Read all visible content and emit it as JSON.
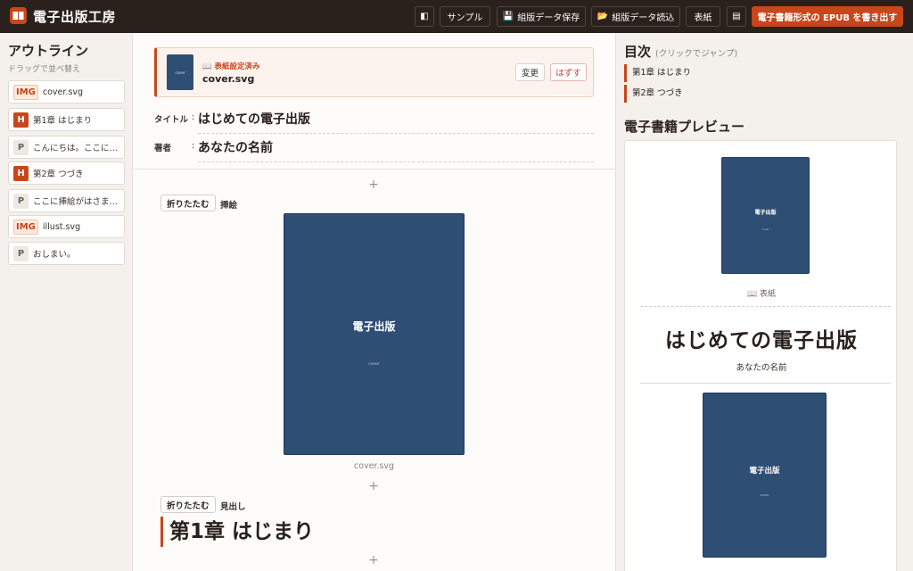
{
  "app": {
    "title": "電子出版工房"
  },
  "toolbar": {
    "toggle_icon": "sidebar-toggle-icon",
    "sample": "サンプル",
    "save": "組版データ保存",
    "load": "組版データ読込",
    "cover": "表紙",
    "menu_icon": "menu-icon",
    "export": "電子書籍形式の EPUB を書き出す"
  },
  "outline": {
    "title": "アウトライン",
    "subtitle": "ドラッグで並べ替え",
    "items": [
      {
        "badge": "IMG",
        "kind": "img",
        "text": "cover.svg"
      },
      {
        "badge": "H",
        "kind": "h",
        "text": "第1章 はじまり"
      },
      {
        "badge": "P",
        "kind": "p",
        "text": "こんにちは。ここに…"
      },
      {
        "badge": "H",
        "kind": "h",
        "text": "第2章 つづき"
      },
      {
        "badge": "P",
        "kind": "p",
        "text": "ここに挿絵がはさま…"
      },
      {
        "badge": "IMG",
        "kind": "img",
        "text": "illust.svg"
      },
      {
        "badge": "P",
        "kind": "p",
        "text": "おしまい。"
      }
    ]
  },
  "editor": {
    "cover": {
      "label": "📖 表紙設定済み",
      "file": "cover.svg",
      "thumb_text": "cover",
      "change": "変更",
      "remove": "はずす"
    },
    "meta": {
      "title_label": "タイトル",
      "title_value": "はじめての電子出版",
      "author_label": "著者",
      "author_value": "あなたの名前",
      "colon": ":"
    },
    "plus": "+",
    "blocks": [
      {
        "fold": "折りたたむ",
        "type": "挿絵",
        "image_title": "電子出版",
        "image_sub": "cover",
        "caption": "cover.svg"
      },
      {
        "fold": "折りたたむ",
        "type": "見出し",
        "heading": "第1章 はじまり"
      }
    ]
  },
  "toc": {
    "title": "目次",
    "subtitle": "(クリックでジャンプ)",
    "items": [
      "第1章 はじまり",
      "第2章 つづき"
    ]
  },
  "preview": {
    "title": "電子書籍プレビュー",
    "cover_title": "電子出版",
    "cover_sub": "cover",
    "cover_caption": "📖 表紙",
    "book_title": "はじめての電子出版",
    "author": "あなたの名前"
  },
  "colors": {
    "accent": "#c8461c",
    "topbar": "#2a201c",
    "cover_blue": "#2e4e74"
  }
}
